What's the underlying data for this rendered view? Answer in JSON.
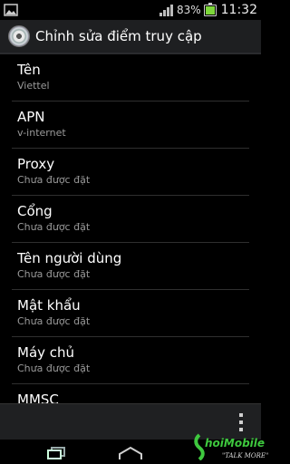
{
  "status_bar": {
    "battery_percent": "83%",
    "time": "11:32",
    "signal_icon": "signal-icon",
    "battery_icon": "battery-icon",
    "notification_icon": "picture-icon"
  },
  "action_bar": {
    "title": "Chỉnh sửa điểm truy cập",
    "icon": "settings-app-icon"
  },
  "list": {
    "items": [
      {
        "title": "Tên",
        "summary": "Viettel"
      },
      {
        "title": "APN",
        "summary": "v-internet"
      },
      {
        "title": "Proxy",
        "summary": "Chưa được đặt"
      },
      {
        "title": "Cổng",
        "summary": "Chưa được đặt"
      },
      {
        "title": "Tên người dùng",
        "summary": "Chưa được đặt"
      },
      {
        "title": "Mật khẩu",
        "summary": "Chưa được đặt"
      },
      {
        "title": "Máy chủ",
        "summary": "Chưa được đặt"
      },
      {
        "title": "MMSC",
        "summary": ""
      }
    ]
  },
  "bottom_bar": {
    "overflow_icon": "overflow-menu-icon"
  },
  "nav_bar": {
    "recent_icon": "recent-apps-icon",
    "home_icon": "home-icon"
  },
  "watermark": {
    "brand": "hoiMobile",
    "tagline": "\"TALK MORE\""
  },
  "colors": {
    "action_bar_bg": "#1e1f21",
    "divider": "#2f2f2f",
    "summary_text": "#9a9a9a",
    "battery_fill": "#7dd63a",
    "watermark_green": "#3ec83e"
  }
}
